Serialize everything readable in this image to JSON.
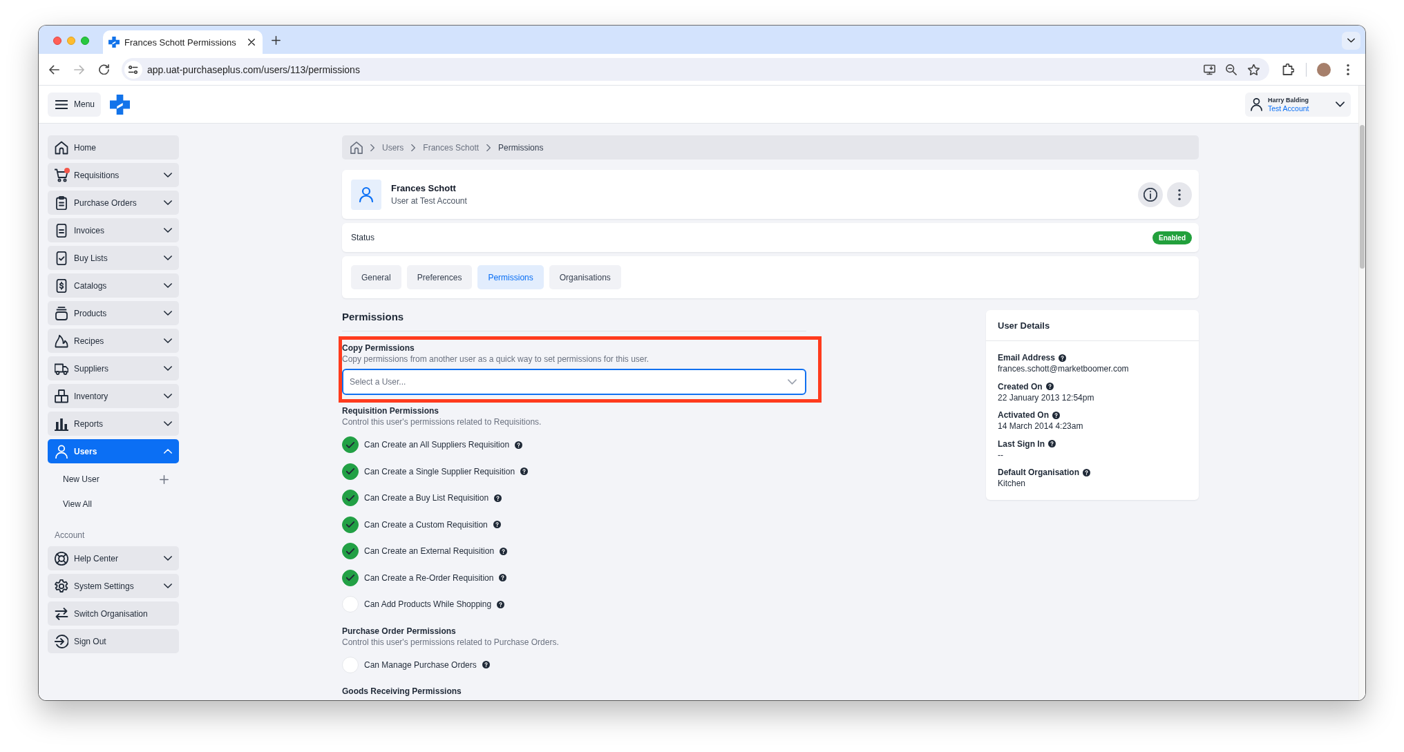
{
  "browser": {
    "tab": {
      "title": "Frances Schott Permissions"
    },
    "address": "app.uat-purchaseplus.com/users/113/permissions"
  },
  "header": {
    "menu": "Menu",
    "user": {
      "name": "Harry Balding",
      "account": "Test Account"
    }
  },
  "sidebar": {
    "groups": [
      {
        "items": [
          {
            "label": "Home",
            "kind": "link",
            "selected": false,
            "notification": false
          },
          {
            "label": "Requisitions",
            "kind": "menu",
            "expanded": false,
            "selected": false,
            "notification": true
          },
          {
            "label": "Purchase Orders",
            "kind": "menu",
            "expanded": false,
            "selected": false,
            "notification": false
          },
          {
            "label": "Invoices",
            "kind": "menu",
            "expanded": false,
            "selected": false,
            "notification": false
          },
          {
            "label": "Buy Lists",
            "kind": "menu",
            "expanded": false,
            "selected": false,
            "notification": false
          },
          {
            "label": "Catalogs",
            "kind": "menu",
            "expanded": false,
            "selected": false,
            "notification": false
          },
          {
            "label": "Products",
            "kind": "menu",
            "expanded": false,
            "selected": false,
            "notification": false
          },
          {
            "label": "Recipes",
            "kind": "menu",
            "expanded": false,
            "selected": false,
            "notification": false
          },
          {
            "label": "Suppliers",
            "kind": "menu",
            "expanded": false,
            "selected": false,
            "notification": false
          },
          {
            "label": "Inventory",
            "kind": "menu",
            "expanded": false,
            "selected": false,
            "notification": false
          },
          {
            "label": "Reports",
            "kind": "menu",
            "expanded": false,
            "selected": false,
            "notification": false
          },
          {
            "label": "Users",
            "kind": "menu",
            "expanded": true,
            "selected": true,
            "notification": false,
            "children": [
              {
                "label": "New User",
                "kind": "add"
              },
              {
                "label": "View All",
                "kind": "link"
              }
            ]
          }
        ]
      },
      {
        "title": "Account",
        "items": [
          {
            "label": "Help Center",
            "kind": "menu",
            "expanded": false,
            "selected": false,
            "notification": false
          },
          {
            "label": "System Settings",
            "kind": "menu",
            "expanded": false,
            "selected": false,
            "notification": false
          },
          {
            "label": "Switch Organisation",
            "kind": "link",
            "selected": false,
            "notification": false
          },
          {
            "label": "Sign Out",
            "kind": "link",
            "selected": false,
            "notification": false
          }
        ]
      }
    ]
  },
  "breadcrumb": [
    "Users",
    "Frances Schott",
    "Permissions"
  ],
  "profile": {
    "name": "Frances Schott",
    "subtitle": "User at Test Account"
  },
  "status": {
    "label": "Status",
    "value": "Enabled"
  },
  "tabs": [
    {
      "label": "General",
      "selected": false
    },
    {
      "label": "Preferences",
      "selected": false
    },
    {
      "label": "Permissions",
      "selected": true
    },
    {
      "label": "Organisations",
      "selected": false
    }
  ],
  "permissions": {
    "title": "Permissions",
    "copy": {
      "label": "Copy Permissions",
      "description": "Copy permissions from another user as a quick way to set permissions for this user.",
      "placeholder": "Select a User...",
      "highlighted": true
    },
    "groups": [
      {
        "title": "Requisition Permissions",
        "description": "Control this user's permissions related to Requisitions.",
        "items": [
          {
            "label": "Can Create an All Suppliers Requisition",
            "checked": true
          },
          {
            "label": "Can Create a Single Supplier Requisition",
            "checked": true
          },
          {
            "label": "Can Create a Buy List Requisition",
            "checked": true
          },
          {
            "label": "Can Create a Custom Requisition",
            "checked": true
          },
          {
            "label": "Can Create an External Requisition",
            "checked": true
          },
          {
            "label": "Can Create a Re-Order Requisition",
            "checked": true
          },
          {
            "label": "Can Add Products While Shopping",
            "checked": false
          }
        ]
      },
      {
        "title": "Purchase Order Permissions",
        "description": "Control this user's permissions related to Purchase Orders.",
        "items": [
          {
            "label": "Can Manage Purchase Orders",
            "checked": false
          }
        ]
      },
      {
        "title": "Goods Receiving Permissions"
      }
    ]
  },
  "user_details": {
    "title": "User Details",
    "fields": [
      {
        "label": "Email Address",
        "value": "frances.schott@marketboomer.com"
      },
      {
        "label": "Created On",
        "value": "22 January 2013 12:54pm"
      },
      {
        "label": "Activated On",
        "value": "14 March 2014 4:23am"
      },
      {
        "label": "Last Sign In",
        "value": "--"
      },
      {
        "label": "Default Organisation",
        "value": "Kitchen"
      }
    ]
  }
}
